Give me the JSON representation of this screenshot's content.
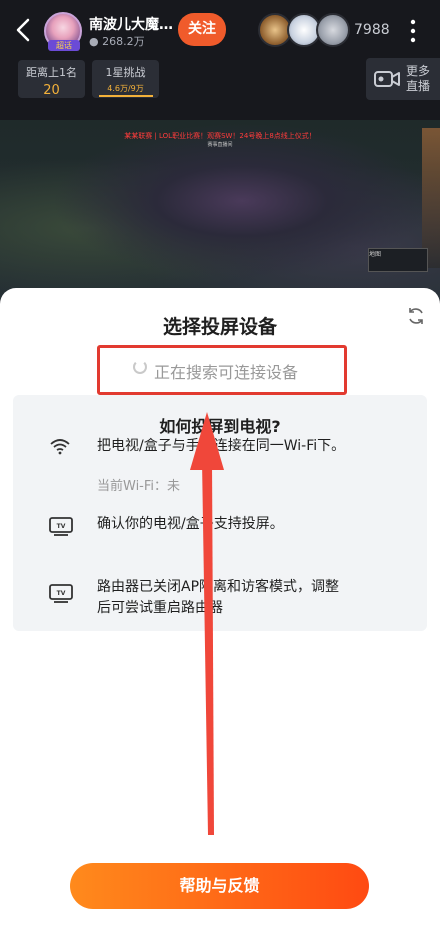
{
  "header": {
    "streamer_name": "南波儿大魔…",
    "fans_count": "268.2万",
    "follow_label": "关注",
    "viewer_count": "7988",
    "avatar_badge": "超话"
  },
  "stats": [
    {
      "title": "距离上1名",
      "value": "20"
    },
    {
      "title": "1星挑战",
      "value": "4.6万/9万"
    }
  ],
  "more_live": {
    "label_line1": "更多",
    "label_line2": "直播"
  },
  "video": {
    "banner": "某某联赛 | LOL职业比赛！观赛SW！24号晚上8点线上仪式！",
    "banner_sub": "赛事直播间",
    "minimap_label": "地图"
  },
  "cast_sheet": {
    "title": "选择投屏设备",
    "searching_text": "正在搜索可连接设备",
    "help": {
      "title": "如何投屏到电视?",
      "items": [
        {
          "icon": "wifi-icon",
          "text": "把电视/盒子与手机连接在同一Wi-Fi下。"
        },
        {
          "icon": "tv-icon",
          "text": "确认你的电视/盒子支持投屏。"
        },
        {
          "icon": "tv-icon",
          "text_line1": "路由器已关闭AP隔离和访客模式，调整",
          "text_line2": "后可尝试重启路由器"
        }
      ],
      "current_wifi": "当前Wi-Fi：未"
    },
    "feedback_button": "帮助与反馈"
  },
  "colors": {
    "accent": "#f05b2b",
    "highlight_box": "#e23a30",
    "button_gradient_start": "#ff8a1c",
    "button_gradient_end": "#ff4a12"
  }
}
